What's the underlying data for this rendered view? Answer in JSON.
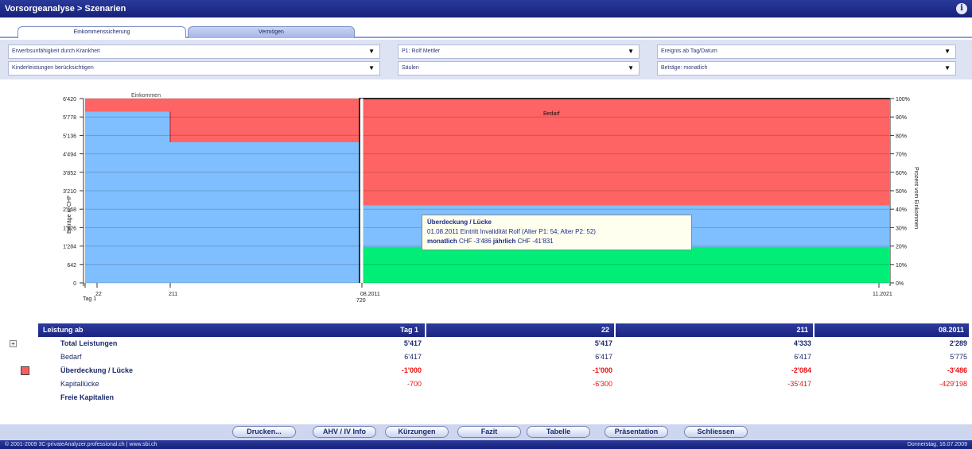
{
  "header": {
    "title": "Vorsorgeanalyse > Szenarien",
    "info_icon": "i"
  },
  "tabs": [
    {
      "label": "Einkommenssicherung"
    },
    {
      "label": "Vermögen"
    }
  ],
  "filters": {
    "row1": [
      "Erwerbsunfähigkeit durch Krankheit",
      "P1: Rolf Mettler",
      "Ereignis ab Tag/Datum"
    ],
    "row2": [
      "Kinderleistungen berücksichtigen",
      "Säulen",
      "Beträge: monatlich"
    ]
  },
  "chart_data": {
    "type": "area",
    "left_label": "Einkommen",
    "right_label": "Bedarf",
    "ylabel": "Beträge in CHF",
    "y2label": "Prozent vom Einkommen",
    "yticks": [
      "6'420",
      "5'778",
      "5'136",
      "4'494",
      "3'852",
      "3'210",
      "2'568",
      "1'926",
      "1'284",
      "642",
      "0"
    ],
    "y2ticks": [
      "100%",
      "90%",
      "80%",
      "70%",
      "60%",
      "50%",
      "40%",
      "30%",
      "20%",
      "10%",
      "0%"
    ],
    "ylim": [
      0,
      6420
    ],
    "xticks": [
      {
        "label": "Tag 1",
        "sub": ""
      },
      {
        "label": "22",
        "sub": ""
      },
      {
        "label": "211",
        "sub": ""
      },
      {
        "label": "08.2011",
        "sub": "720"
      },
      {
        "label": "11.2021",
        "sub": ""
      }
    ],
    "segments": [
      {
        "phase": "Einkommen",
        "from": "Tag 1",
        "to": "22",
        "income": 6417,
        "benefits": 5964
      },
      {
        "phase": "Einkommen",
        "from": "22",
        "to": "211",
        "income": 6417,
        "benefits": 5964
      },
      {
        "phase": "Einkommen",
        "from": "211",
        "to": "720",
        "income": 6417,
        "benefits": 4900
      },
      {
        "phase": "Bedarf",
        "from": "08.2011",
        "to": "11.2021",
        "need": 6417,
        "benefits": 2700,
        "green": 1250
      }
    ],
    "colors": {
      "gap": "#ff6464",
      "benefits": "#7fbfff",
      "green": "#00ee77"
    }
  },
  "tooltip": {
    "title": "Überdeckung / Lücke",
    "line2": "01.08.2011 Eintritt Invalidität Rolf (Alter P1: 54;  Alter P2: 52)",
    "monthly_label": "monatlich",
    "monthly_value": "CHF -3'486",
    "yearly_label": "jährlich",
    "yearly_value": "CHF -41'831"
  },
  "table": {
    "headers": [
      "Leistung ab",
      "Tag 1",
      "22",
      "211",
      "08.2011"
    ],
    "rows": [
      {
        "label": "Total Leistungen",
        "values": [
          "5'417",
          "5'417",
          "4'333",
          "2'289"
        ]
      },
      {
        "label": "Bedarf",
        "values": [
          "6'417",
          "6'417",
          "6'417",
          "5'775"
        ]
      },
      {
        "label": "Überdeckung / Lücke",
        "values": [
          "-1'000",
          "-1'000",
          "-2'084",
          "-3'486"
        ]
      },
      {
        "label": "Kapitallücke",
        "values": [
          "-700",
          "-6'300",
          "-35'417",
          "-429'198"
        ]
      },
      {
        "label": "Freie Kapitalien",
        "values": [
          "",
          "",
          "",
          ""
        ]
      }
    ]
  },
  "buttons": [
    "Drucken...",
    "AHV / IV Info",
    "Kürzungen",
    "Fazit",
    "Tabelle",
    "Präsentation",
    "Schliessen"
  ],
  "footer": {
    "left": "© 2001-2009 3C-privateAnalyzer.professional.ch | www.sbi.ch",
    "right": "Donnerstag, 16.07.2009"
  }
}
